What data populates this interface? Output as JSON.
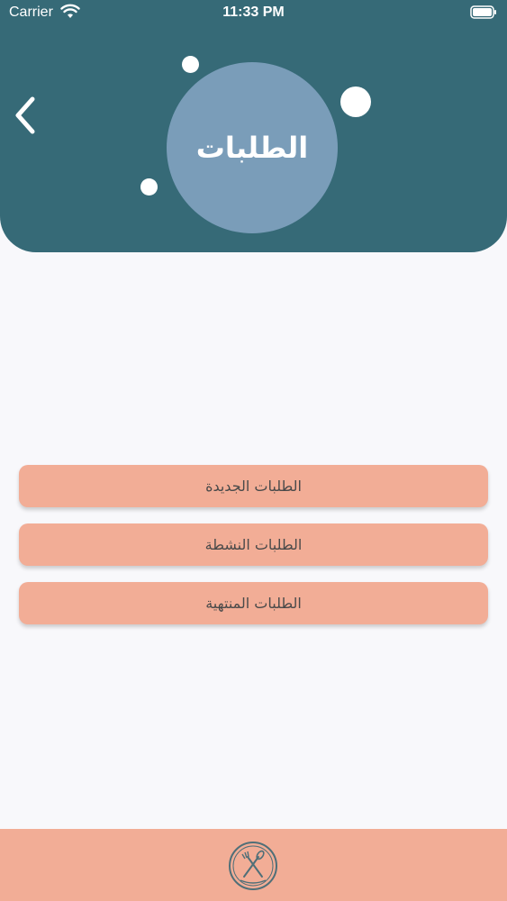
{
  "status_bar": {
    "carrier": "Carrier",
    "time": "11:33 PM"
  },
  "header": {
    "title": "الطلبات",
    "back_icon": "chevron-left-icon",
    "background_color": "#366a77",
    "circle_color": "#7a9db9"
  },
  "menu": {
    "items": [
      {
        "label": "الطلبات الجديدة"
      },
      {
        "label": "الطلبات النشطة"
      },
      {
        "label": "الطلبات المنتهية"
      }
    ],
    "button_color": "#f2ad96"
  },
  "footer": {
    "logo_icon": "home-made-logo-icon",
    "background_color": "#f2ad96"
  }
}
